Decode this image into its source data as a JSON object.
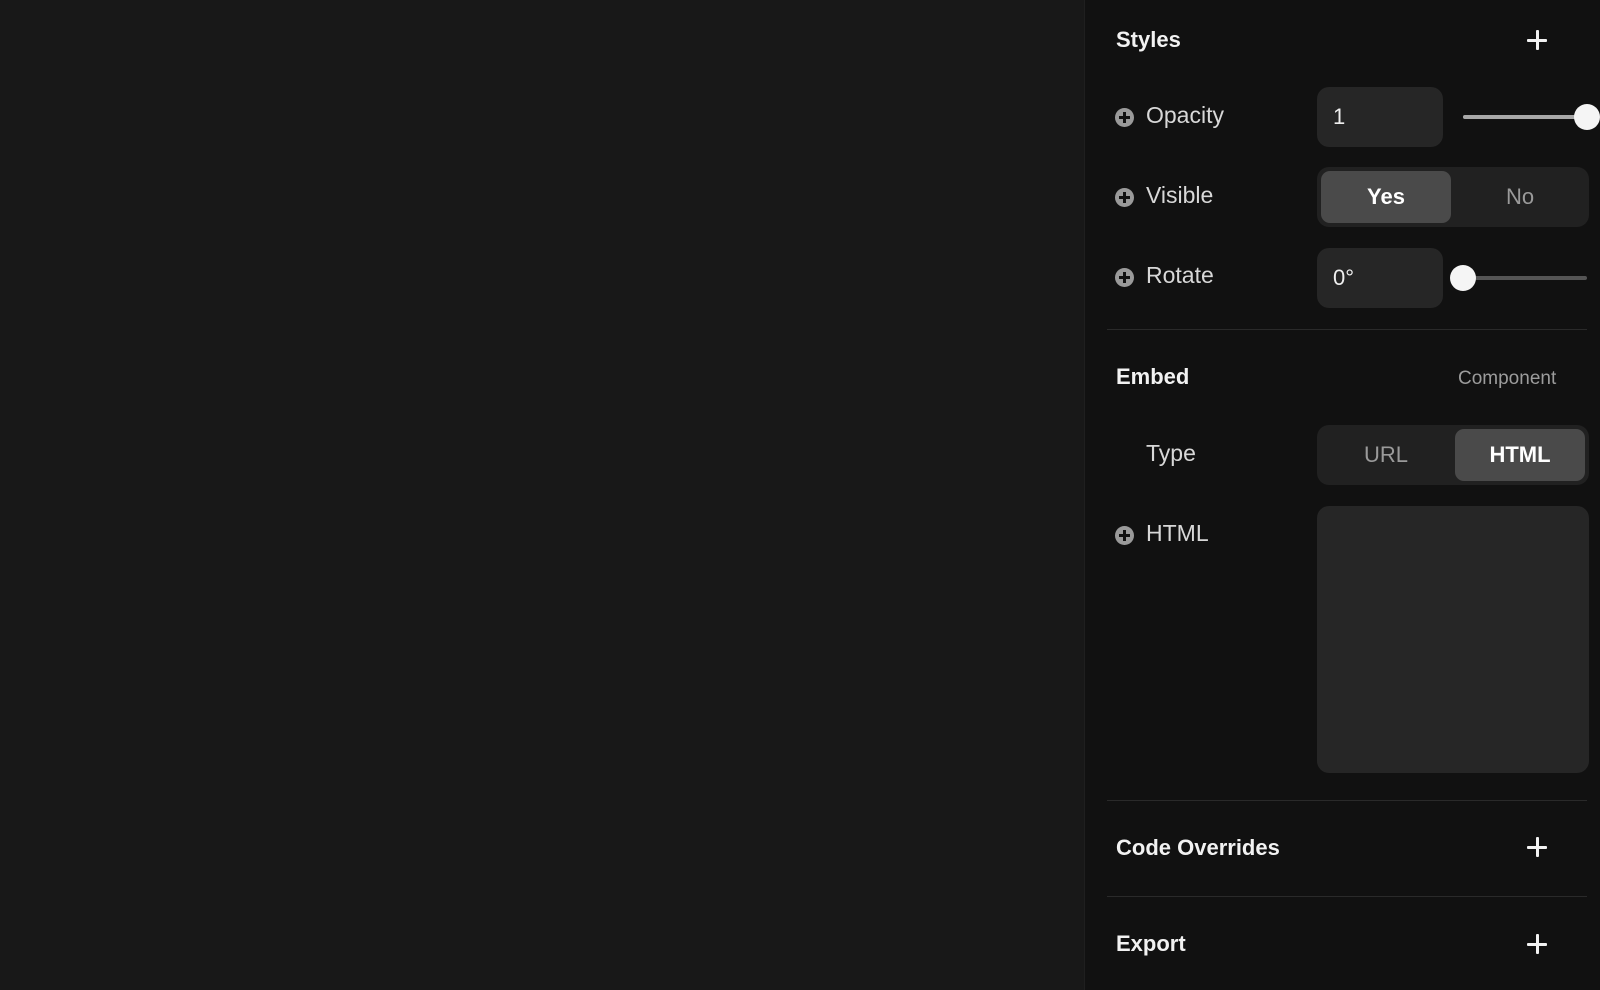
{
  "styles": {
    "title": "Styles",
    "opacity": {
      "label": "Opacity",
      "value": "1",
      "slider_fraction": 1.0
    },
    "visible": {
      "label": "Visible",
      "options": [
        "Yes",
        "No"
      ],
      "selected": "Yes"
    },
    "rotate": {
      "label": "Rotate",
      "value": "0°",
      "slider_fraction": 0.0
    }
  },
  "embed": {
    "title": "Embed",
    "component_label": "Component",
    "type": {
      "label": "Type",
      "options": [
        "URL",
        "HTML"
      ],
      "selected": "HTML"
    },
    "html": {
      "label": "HTML",
      "value": ""
    }
  },
  "code_overrides": {
    "title": "Code Overrides"
  },
  "export": {
    "title": "Export"
  },
  "colors": {
    "canvas_bg": "#181818",
    "panel_bg": "#111111",
    "active_segment": "#4a4a4a"
  },
  "icons": {
    "add_section": "plus-icon",
    "add_property": "circle-plus-icon"
  }
}
